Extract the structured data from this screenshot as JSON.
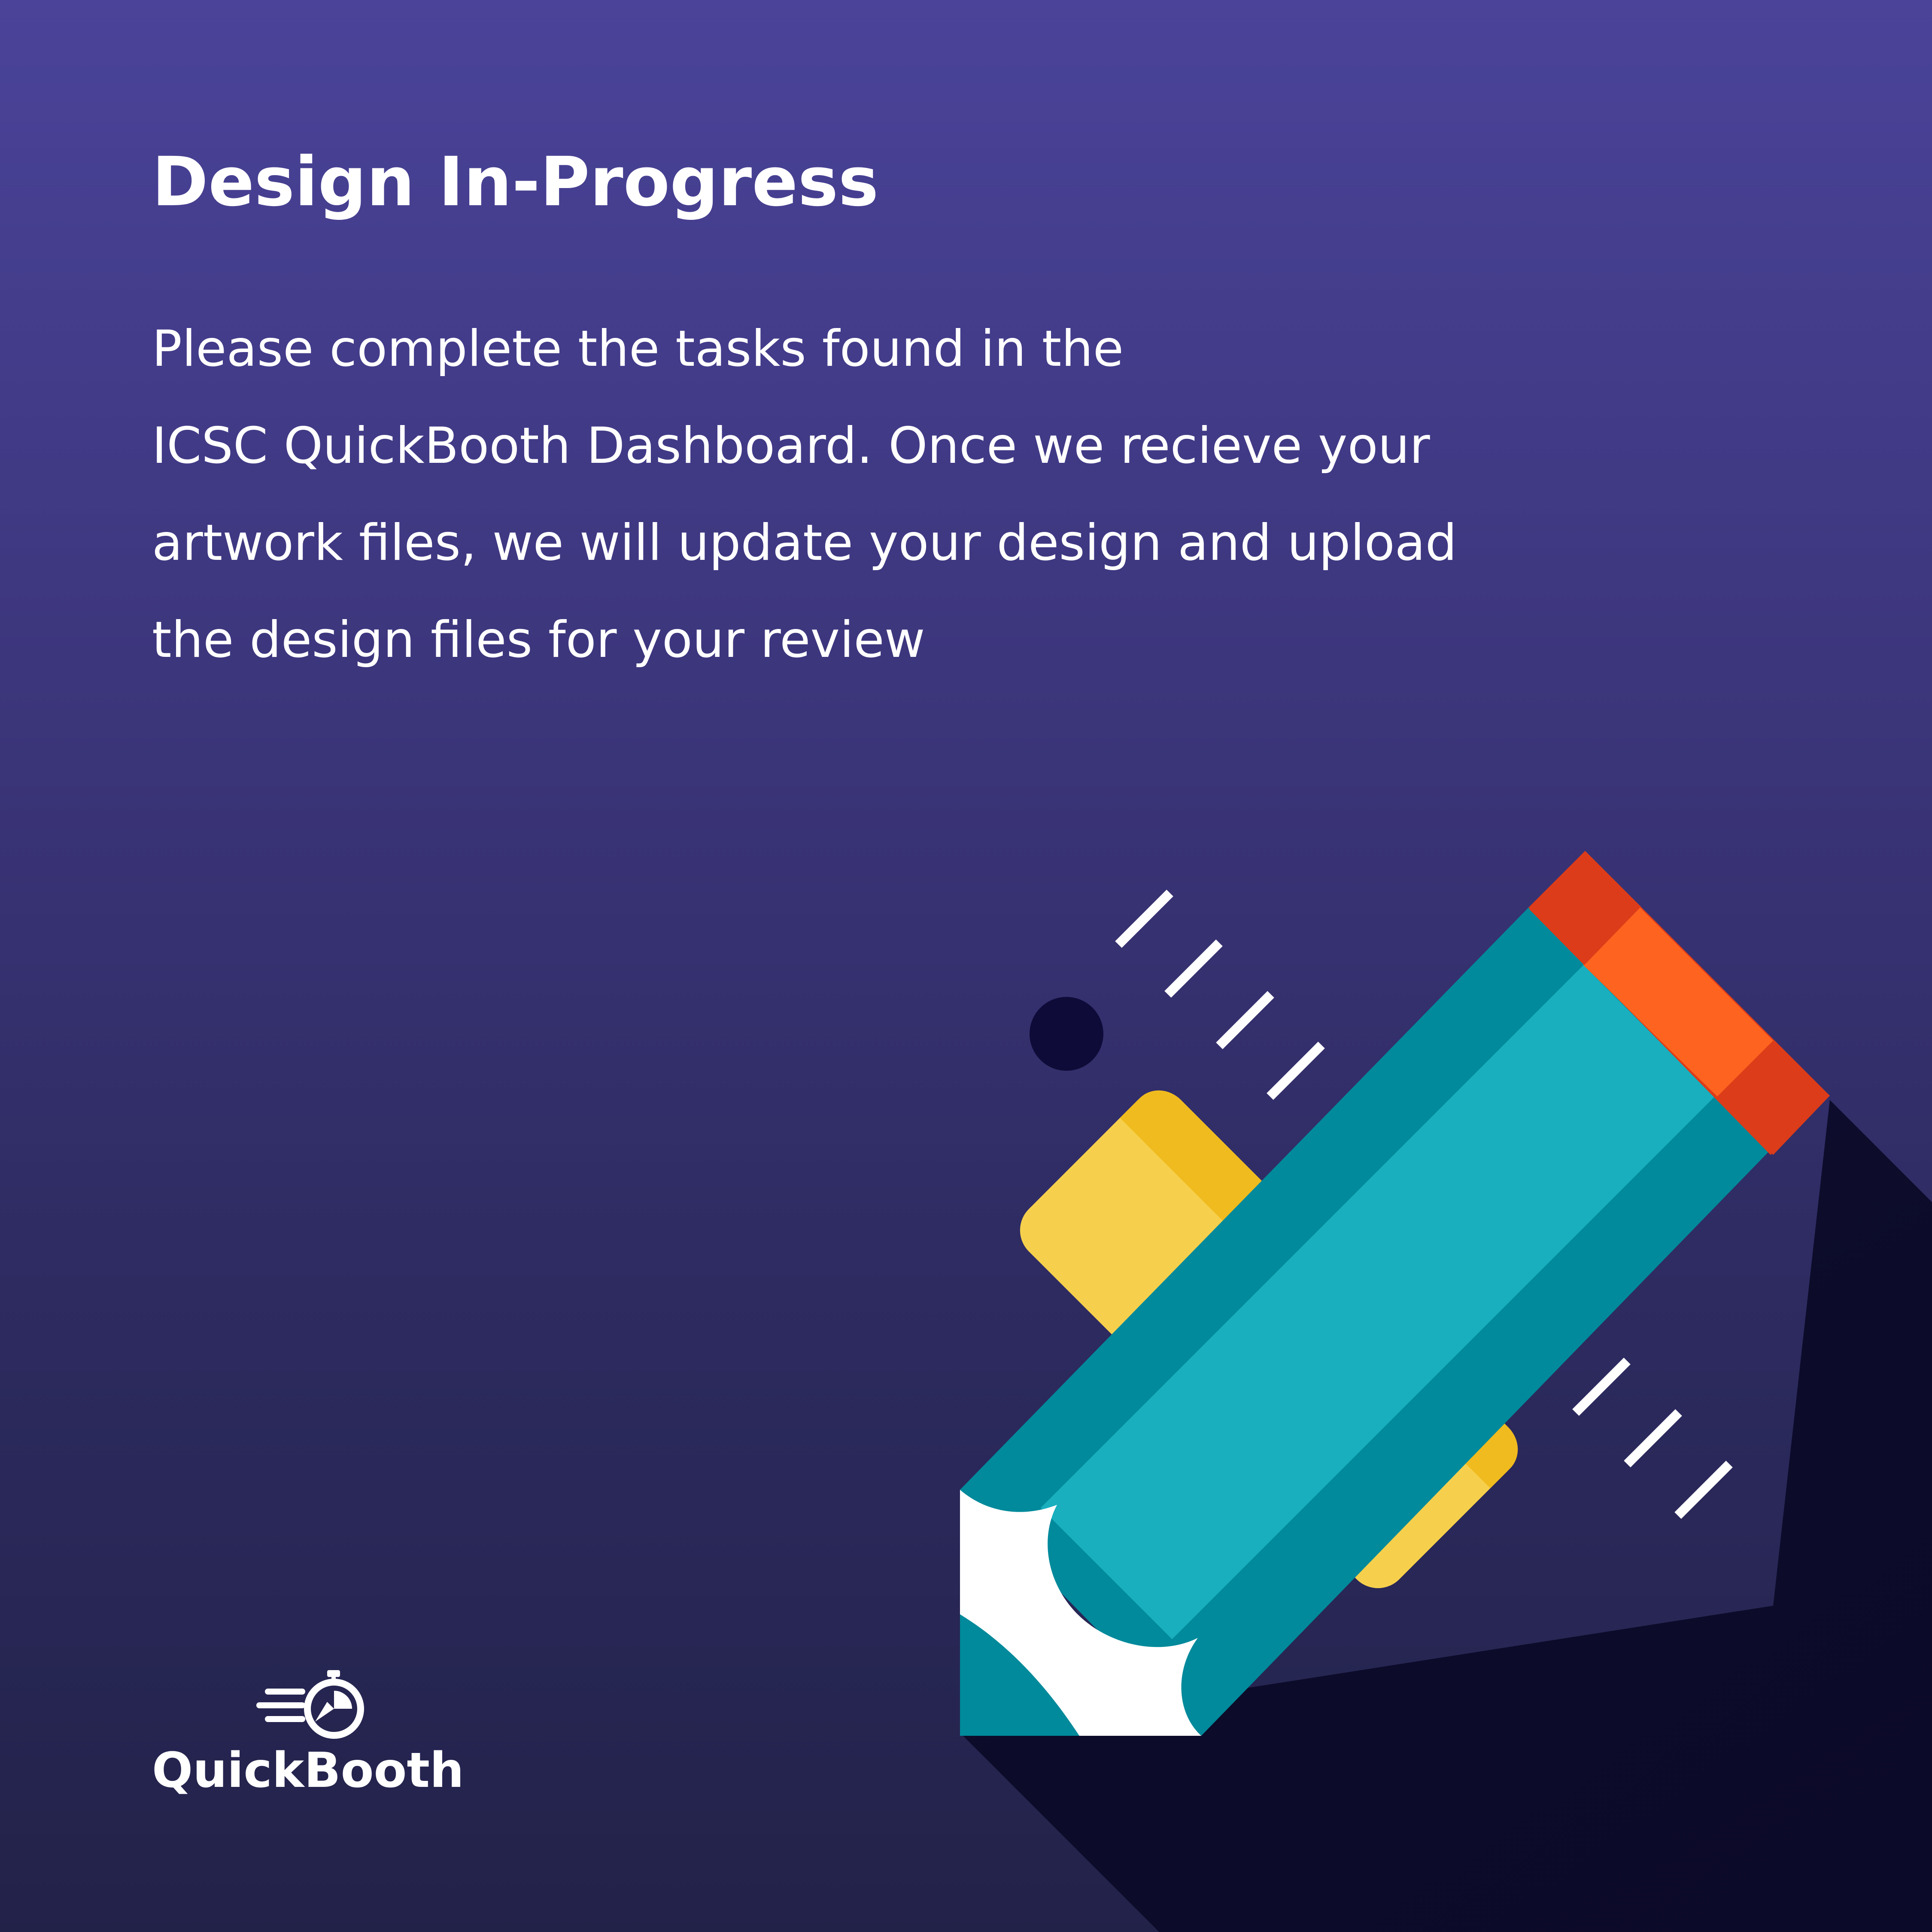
{
  "heading": "Design In-Progress",
  "message": {
    "lines": [
      "Please complete the tasks found in the",
      "ICSC QuickBooth Dashboard. Once we recieve your",
      "artwork files, we will update your design and upload",
      "the design files for your review"
    ]
  },
  "illustration": {
    "icon": "ruler-and-pencil-icon"
  },
  "brand": {
    "name": "QuickBooth",
    "logo_icon": "stopwatch-speed-icon"
  },
  "colors": {
    "background_top": "#4a4399",
    "background_bottom": "#222249",
    "ruler": "#f6d04d",
    "ruler_edge": "#f0bb1e",
    "pencil_body": "#19afbe",
    "pencil_edge": "#008a9b",
    "pencil_eraser": "#ff6320",
    "pencil_band": "#dc3c19",
    "shadow": "#0b0a28"
  }
}
